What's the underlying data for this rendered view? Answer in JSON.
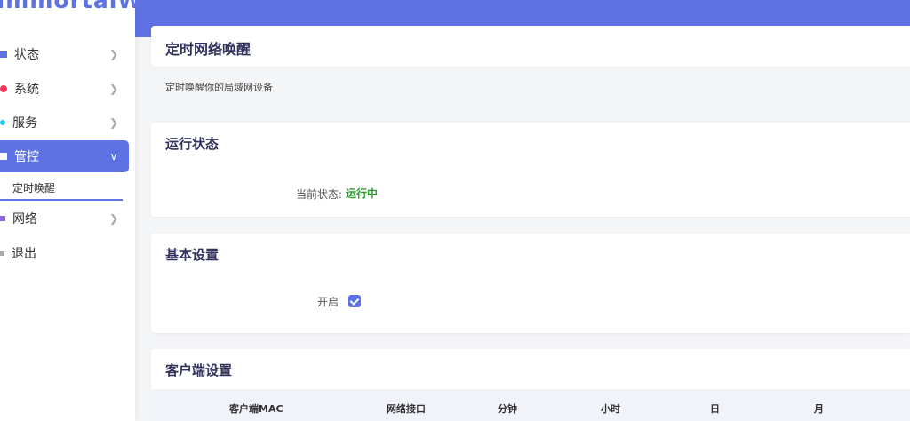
{
  "app": {
    "logo_text": "ImmortalWrt"
  },
  "sidebar": {
    "items": [
      {
        "label": "状态",
        "icon": "status-icon",
        "color": "#5e72e4"
      },
      {
        "label": "系统",
        "icon": "gear-icon",
        "color": "#f5365c"
      },
      {
        "label": "服务",
        "icon": "services-icon",
        "color": "#11cdef"
      },
      {
        "label": "管控",
        "icon": "control-icon",
        "color": "#ffffff"
      },
      {
        "label": "网络",
        "icon": "network-icon",
        "color": "#8965e0"
      },
      {
        "label": "退出",
        "icon": "logout-icon",
        "color": "#aaaaaa"
      }
    ],
    "sub_item": "定时唤醒"
  },
  "page": {
    "title": "定时网络唤醒",
    "description": "定时唤醒你的局域网设备"
  },
  "run_status": {
    "title": "运行状态",
    "label": "当前状态:",
    "value": "运行中"
  },
  "basic_settings": {
    "title": "基本设置",
    "enable_label": "开启"
  },
  "client_settings": {
    "title": "客户端设置",
    "columns": [
      "客户端MAC",
      "网络接口",
      "分钟",
      "小时",
      "日",
      "月"
    ]
  },
  "colors": {
    "accent": "#5e72e4",
    "running": "#2e9a2e"
  }
}
